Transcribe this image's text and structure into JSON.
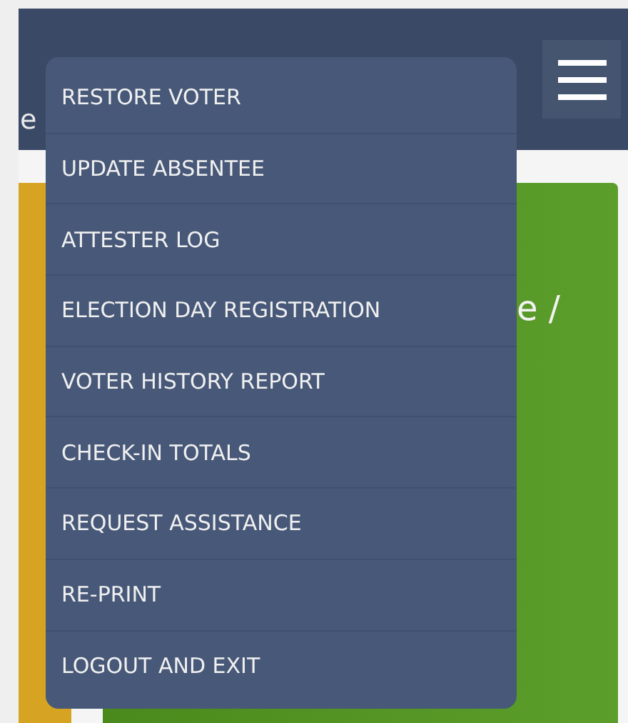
{
  "header": {
    "title_fragment": "e"
  },
  "card": {
    "heading_fragment": "e /"
  },
  "menu": {
    "items": [
      {
        "label": "RESTORE VOTER"
      },
      {
        "label": "UPDATE ABSENTEE"
      },
      {
        "label": "ATTESTER LOG"
      },
      {
        "label": "ELECTION DAY REGISTRATION"
      },
      {
        "label": "VOTER HISTORY REPORT"
      },
      {
        "label": "CHECK-IN TOTALS"
      },
      {
        "label": "REQUEST ASSISTANCE"
      },
      {
        "label": "RE-PRINT"
      },
      {
        "label": "LOGOUT AND EXIT"
      }
    ]
  }
}
